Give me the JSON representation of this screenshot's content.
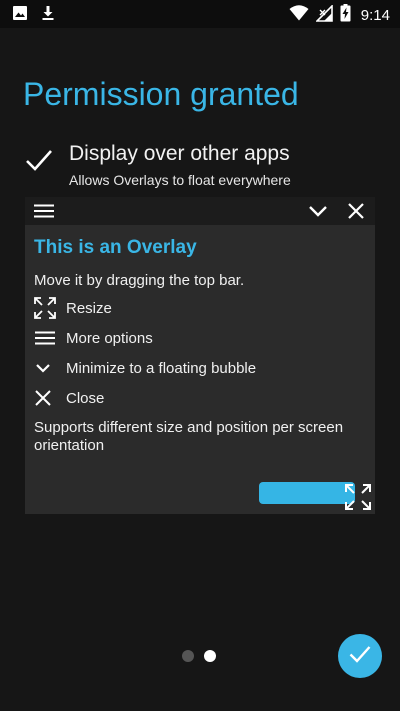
{
  "status_bar": {
    "time": "9:14",
    "left_icons": [
      "image-icon",
      "download-icon"
    ],
    "right_icons": [
      "wifi-icon",
      "signal-icon",
      "battery-charging-icon"
    ]
  },
  "page": {
    "title": "Permission granted"
  },
  "permission": {
    "icon": "checkmark-icon",
    "title": "Display over other apps",
    "subtitle": "Allows Overlays to float everywhere"
  },
  "overlay": {
    "toolbar_icons": [
      "menu-icon",
      "chevron-down-icon",
      "close-icon"
    ],
    "title": "This is an Overlay",
    "description": "Move it by dragging the top bar.",
    "features": [
      {
        "icon": "resize-icon",
        "label": "Resize"
      },
      {
        "icon": "menu-icon",
        "label": "More options"
      },
      {
        "icon": "chevron-down-icon",
        "label": "Minimize to a floating bubble"
      },
      {
        "icon": "close-icon",
        "label": "Close"
      }
    ],
    "note": "Supports different size and position per screen orientation"
  },
  "pager": {
    "total": 2,
    "active_index": 1
  },
  "fab": {
    "icon": "checkmark-icon"
  },
  "colors": {
    "accent": "#3ab6e6",
    "background": "#161616",
    "overlay_bg": "#2b2b2b",
    "overlay_bar": "#1c1c1c"
  }
}
